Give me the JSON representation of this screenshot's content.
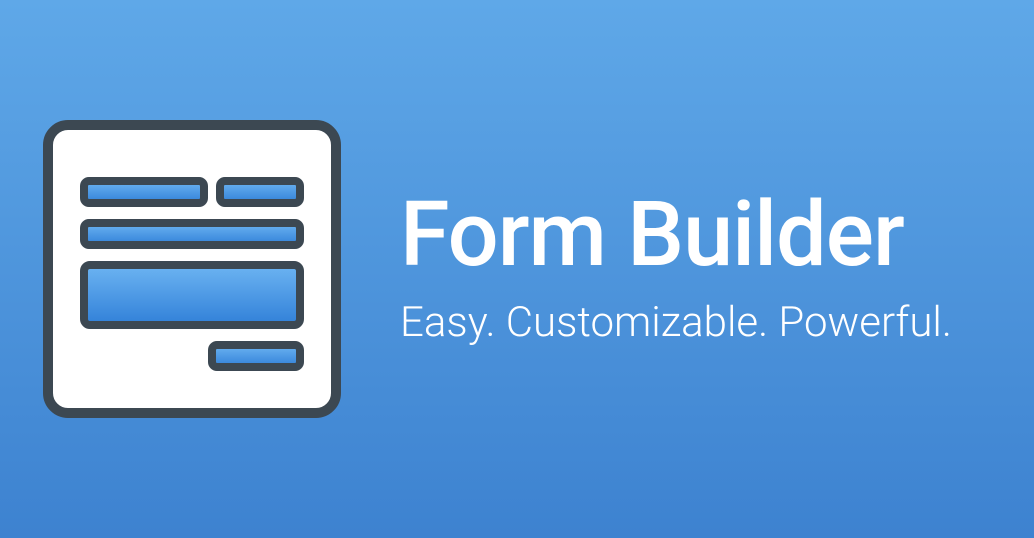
{
  "hero": {
    "title": "Form Builder",
    "subtitle": "Easy. Customizable. Powerful."
  }
}
